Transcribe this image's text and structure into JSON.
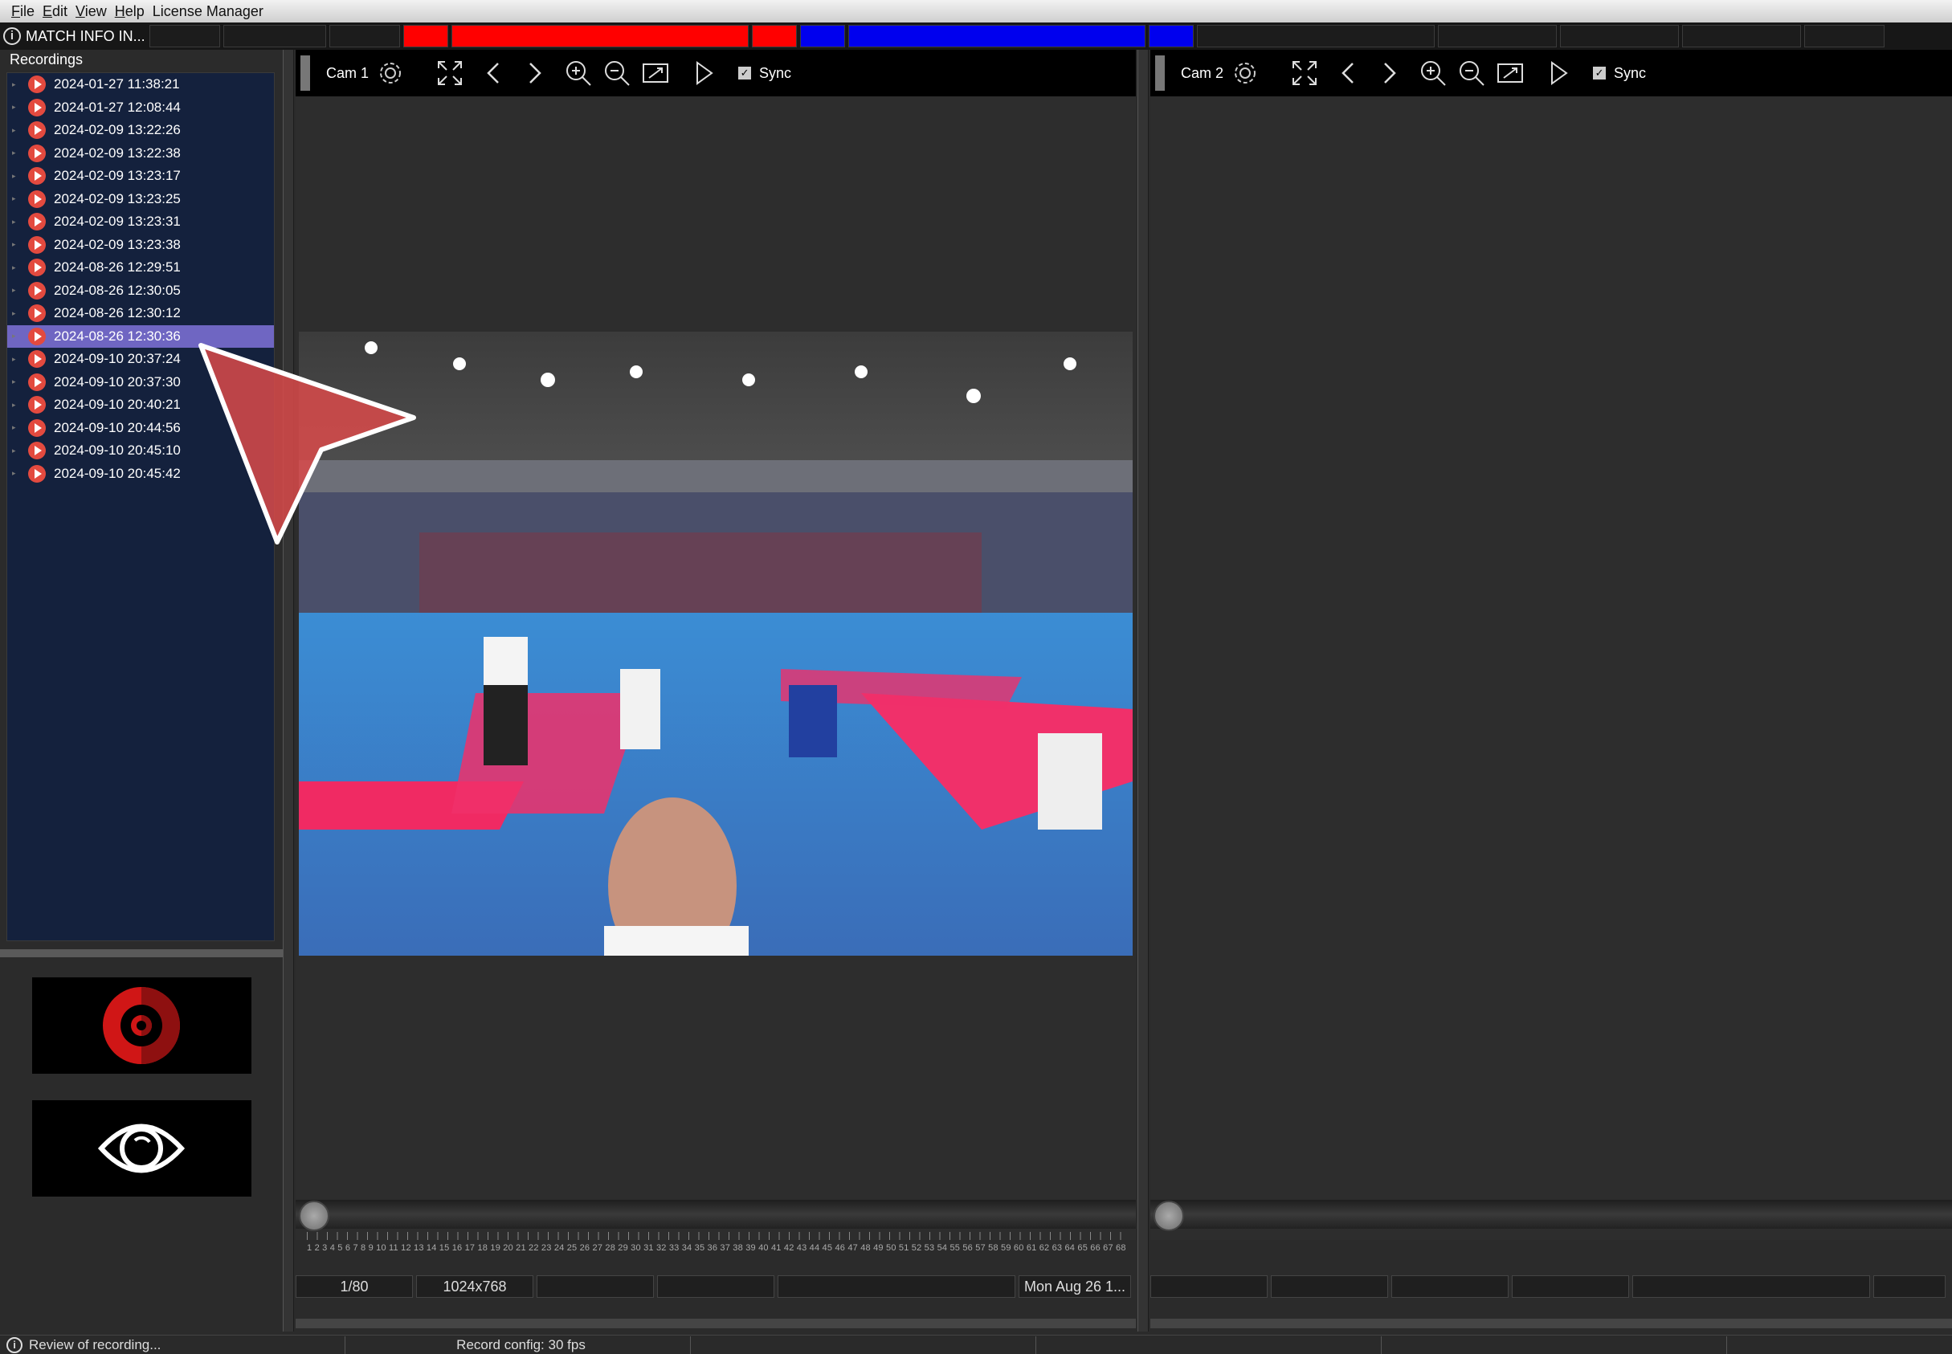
{
  "menu": {
    "file": "File",
    "edit": "Edit",
    "view": "View",
    "help": "Help",
    "license": "License Manager"
  },
  "infobar": {
    "match_info": "MATCH INFO IN...",
    "accent_red": "#ff0000",
    "accent_blue": "#0000ee"
  },
  "recordings": {
    "title": "Recordings",
    "items": [
      {
        "label": "2024-01-27 11:38:21"
      },
      {
        "label": "2024-01-27 12:08:44"
      },
      {
        "label": "2024-02-09 13:22:26"
      },
      {
        "label": "2024-02-09 13:22:38"
      },
      {
        "label": "2024-02-09 13:23:17"
      },
      {
        "label": "2024-02-09 13:23:25"
      },
      {
        "label": "2024-02-09 13:23:31"
      },
      {
        "label": "2024-02-09 13:23:38"
      },
      {
        "label": "2024-08-26 12:29:51"
      },
      {
        "label": "2024-08-26 12:30:05"
      },
      {
        "label": "2024-08-26 12:30:12"
      },
      {
        "label": "2024-08-26 12:30:36",
        "selected": true
      },
      {
        "label": "2024-09-10 20:37:24"
      },
      {
        "label": "2024-09-10 20:37:30"
      },
      {
        "label": "2024-09-10 20:40:21"
      },
      {
        "label": "2024-09-10 20:44:56"
      },
      {
        "label": "2024-09-10 20:45:10"
      },
      {
        "label": "2024-09-10 20:45:42"
      }
    ]
  },
  "left_buttons": {
    "record_icon": "record-icon",
    "review_icon": "eye-icon"
  },
  "cam1": {
    "label": "Cam 1",
    "sync_label": "Sync",
    "sync_checked": true,
    "frame": "1/80",
    "resolution": "1024x768",
    "date": "Mon Aug 26 1...",
    "position_fraction": 0
  },
  "cam2": {
    "label": "Cam 2",
    "sync_label": "Sync",
    "sync_checked": true,
    "position_fraction": 0
  },
  "statusbar": {
    "message": "Review of recording...",
    "record_config": "Record config: 30 fps"
  }
}
